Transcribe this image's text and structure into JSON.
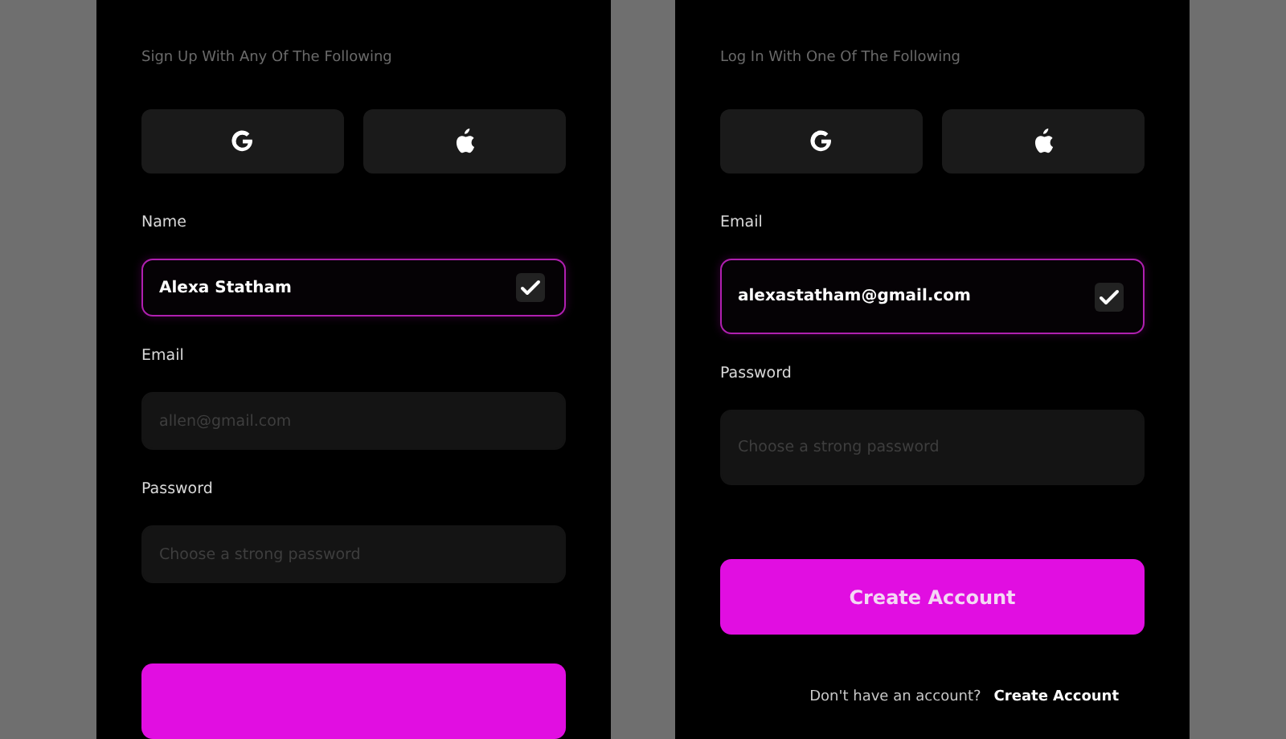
{
  "panels": [
    {
      "subtitle": "Sign Up With Any Of The Following",
      "social": [
        {
          "kind": "google"
        },
        {
          "kind": "apple"
        }
      ],
      "fields": [
        {
          "label": "Name",
          "value": "Alexa Statham",
          "valid": true
        },
        {
          "label": "Email",
          "placeholder": "allen@gmail.com",
          "valid": false
        },
        {
          "label": "Password",
          "placeholder": "Choose a strong password",
          "valid": false
        }
      ],
      "submit": {
        "kind": "primary"
      }
    },
    {
      "subtitle": "Log In With One Of The Following",
      "social": [
        {
          "kind": "google"
        },
        {
          "kind": "apple"
        }
      ],
      "fields": [
        {
          "label": "Email",
          "value": "alexastatham@gmail.com",
          "valid": true
        },
        {
          "label": "Password",
          "placeholder": "Choose a strong password",
          "valid": false
        }
      ],
      "submit": {
        "kind": "primary",
        "label": "Create Account"
      },
      "footer": {
        "text": "Don't have an account?",
        "link": "Create Account"
      }
    }
  ]
}
